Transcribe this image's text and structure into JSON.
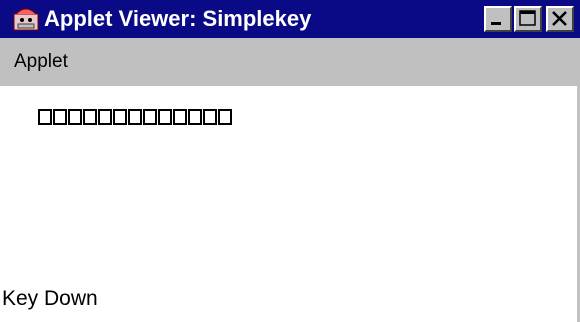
{
  "window": {
    "title": "Applet Viewer: Simplekey",
    "icon": "applet-viewer-icon",
    "controls": {
      "minimize": "minimize-icon",
      "maximize": "maximize-icon",
      "close": "close-icon"
    }
  },
  "menubar": {
    "items": [
      {
        "label": "Applet"
      }
    ]
  },
  "content": {
    "typed_boxes_count": 13,
    "status": "Key Down"
  },
  "colors": {
    "titlebar": "#0a0a86",
    "menubar": "#c0c0c0",
    "background": "#ffffff"
  }
}
